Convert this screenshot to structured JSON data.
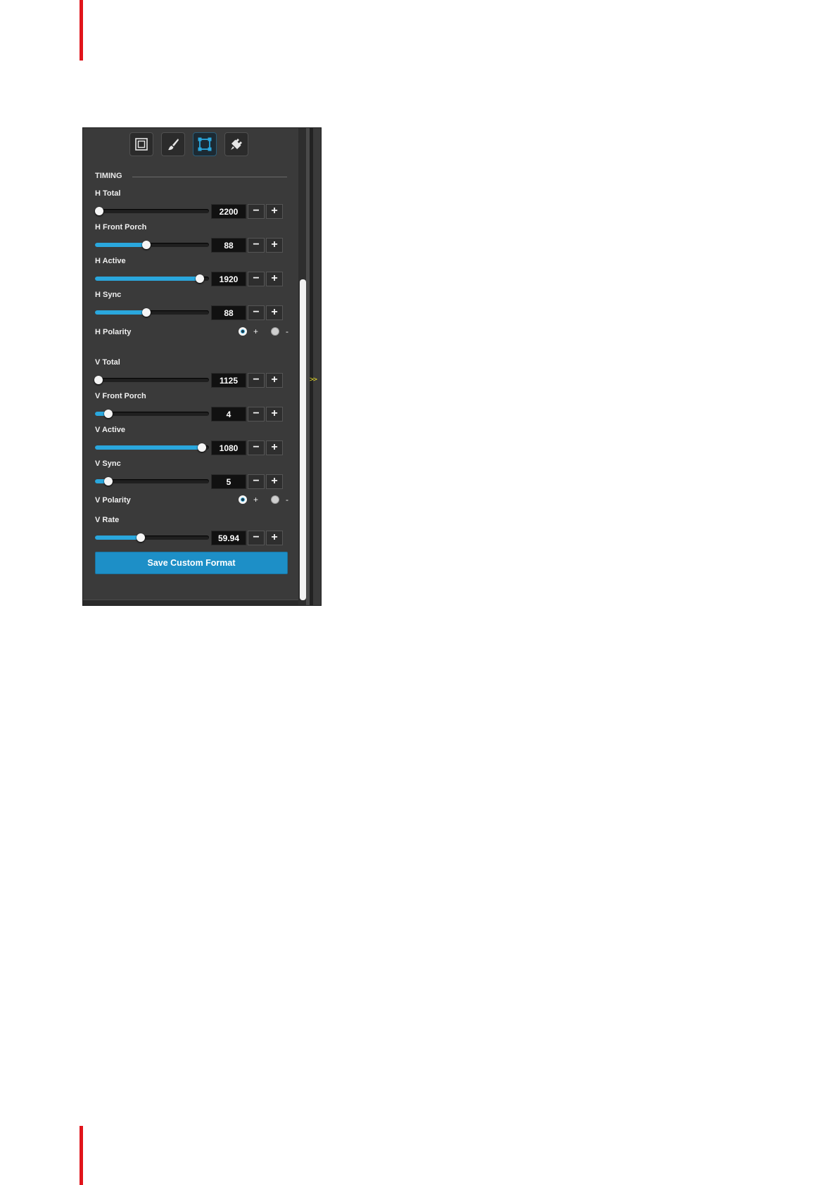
{
  "colors": {
    "accent": "#2aa7dd",
    "page_marks": "#e1141b",
    "panel_bg": "#3a3a3a",
    "save_button": "#1d8fc7",
    "collapse_arrow": "#e3d82a"
  },
  "tabs": [
    {
      "icon": "frame-icon",
      "active": false
    },
    {
      "icon": "brush-icon",
      "active": false
    },
    {
      "icon": "crop-corners-icon",
      "active": true
    },
    {
      "icon": "plug-icon",
      "active": false
    }
  ],
  "section_title": "TIMING",
  "parameters": [
    {
      "label": "H Total",
      "value": "2200",
      "level": 0.04
    },
    {
      "label": "H Front Porch",
      "value": "88",
      "level": 0.45
    },
    {
      "label": "H Active",
      "value": "1920",
      "level": 0.92
    },
    {
      "label": "H Sync",
      "value": "88",
      "level": 0.45
    },
    {
      "label": "V Total",
      "value": "1125",
      "level": 0.03
    },
    {
      "label": "V Front Porch",
      "value": "4",
      "level": 0.12
    },
    {
      "label": "V Active",
      "value": "1080",
      "level": 0.94
    },
    {
      "label": "V Sync",
      "value": "5",
      "level": 0.12
    },
    {
      "label": "V Rate",
      "value": "59.94",
      "level": 0.4
    }
  ],
  "stepper": {
    "minus": "−",
    "plus": "+"
  },
  "polarity": [
    {
      "label": "H Polarity",
      "plus_label": "+",
      "minus_label": "-",
      "selected": "+"
    },
    {
      "label": "V Polarity",
      "plus_label": "+",
      "minus_label": "-",
      "selected": "+"
    }
  ],
  "collapse_label": ">>",
  "save_button": "Save Custom Format"
}
